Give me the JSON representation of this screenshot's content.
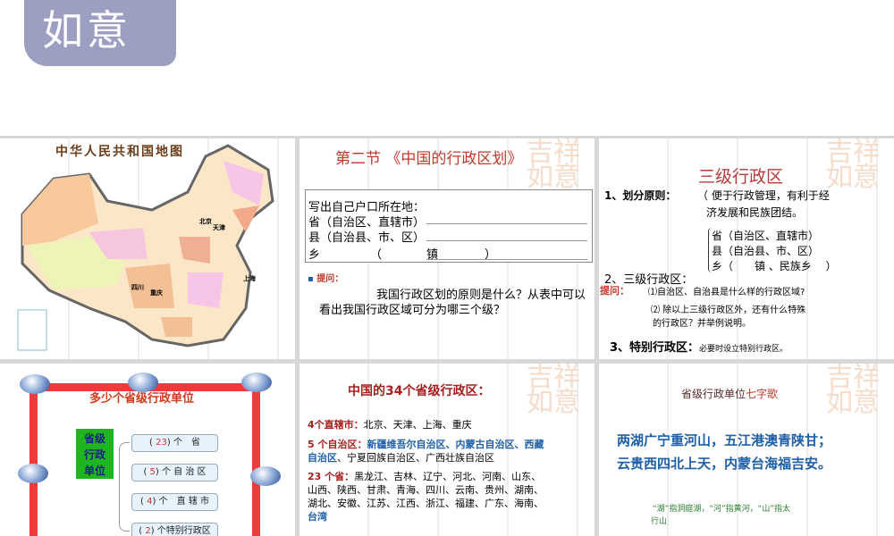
{
  "seal": {
    "text": "如意"
  },
  "map_slide": {
    "title": "中华人民共和国地图",
    "labels": [
      "北京",
      "天津",
      "上海",
      "四川",
      "重庆"
    ]
  },
  "section_slide": {
    "title": "第二节 《中国的行政区划》",
    "prompt": "写出自己户口所在地：",
    "row1": "省（自治区、直辖市）",
    "row2": "县（自治县、市、区）",
    "row3a": "乡",
    "row3b": "（",
    "row3c": "镇",
    "row3d": "）",
    "ask_label": "提问：",
    "question": "我国行政区划的原则是什么？从表中可以看出我国行政区域可分为哪三个级？"
  },
  "levels_slide": {
    "title": "三级行政区",
    "p1_label": "1、划分原则：",
    "p1_text1": "（ 便于行政管理，有利于经",
    "p1_text2": "济发展和民族团结。",
    "b1": "省（自治区、直辖市）",
    "b2": "县（自治县、市、区）",
    "b3": "乡（　　镇 、民族乡　 ）",
    "p2_label": "2、三级行政区：",
    "ask_label": "提问：",
    "q1": "⑴自治区、自治县是什么样的行政区域?",
    "q2a": "⑵ 除以上三级行政区外，还有什么特殊",
    "q2b": "的行政区？并举例说明。",
    "p3_label": "3、特别行政区：",
    "p3_text": "必要时设立特别行政区。"
  },
  "units_slide": {
    "title": "多少个省级行政单位",
    "center": [
      "省级",
      "行政",
      "单位"
    ],
    "nodes": [
      {
        "n": "23",
        "label": "个　省",
        "pre": "("
      },
      {
        "n": "5",
        "label": "个 自 治 区",
        "pre": "("
      },
      {
        "n": "4",
        "label": "个　直 辖 市",
        "pre": "("
      },
      {
        "n": "2",
        "label": "个特别行政区",
        "pre": "("
      }
    ]
  },
  "provinces_slide": {
    "title": "中国的34个省级行政区：",
    "m_label": "4个直辖市：",
    "m_text": "北京、天津、上海、重庆",
    "a_label": "5 个自治区：",
    "a_blue1": "新疆维吾尔自治区、内蒙古自治区、西藏",
    "a_blue2": "自治区",
    "a_text": "、宁夏回族自治区、广西壮族自治区",
    "p_label": "23 个省：",
    "p_text1": "黑龙江、吉林、辽宁、河北、河南、山东、",
    "p_text2": "山西、陕西、甘肃、青海、四川、云南、贵州、湖南、",
    "p_text3": "湖北、安徽、江苏、江西、浙江、福建、广东、海南、",
    "p_blue": "台湾"
  },
  "song_slide": {
    "title_a": "省级行政单位",
    "title_b": "七字歌",
    "line1": "两湖广宁重河山，五江港澳青陕甘；",
    "line2": "云贵西四北上天，内蒙台海福吉安。",
    "note1": "“湖”指洞庭湖，“河”指黄河，“山”指太",
    "note2": "行山"
  },
  "colors": {
    "red": "#c0392b",
    "blue": "#1f5fa8",
    "green": "#2e7d32"
  }
}
